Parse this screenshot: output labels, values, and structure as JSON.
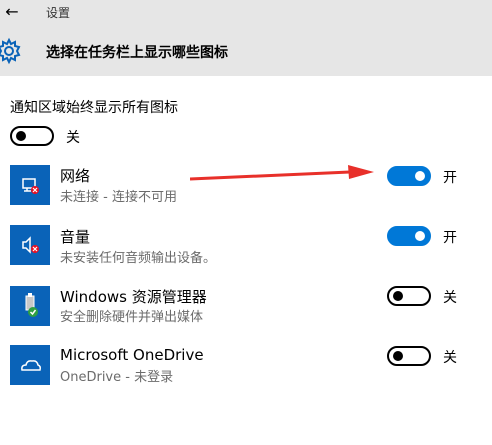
{
  "header": {
    "back_glyph": "←",
    "app_title": "设置",
    "page_title": "选择在任务栏上显示哪些图标"
  },
  "always_show": {
    "label": "通知区域始终显示所有图标",
    "state": "关",
    "on": false
  },
  "apps": [
    {
      "name": "网络",
      "status": "未连接 - 连接不可用",
      "state": "开",
      "on": true,
      "icon": "network-disconnected-icon"
    },
    {
      "name": "音量",
      "status": "未安装任何音频输出设备。",
      "state": "开",
      "on": true,
      "icon": "volume-muted-icon"
    },
    {
      "name": "Windows 资源管理器",
      "status": "安全删除硬件并弹出媒体",
      "state": "关",
      "on": false,
      "icon": "safely-remove-hardware-icon"
    },
    {
      "name": "Microsoft OneDrive",
      "status": "OneDrive - 未登录",
      "state": "关",
      "on": false,
      "icon": "onedrive-cloud-icon"
    }
  ],
  "colors": {
    "accent": "#0078d7",
    "icon_tile": "#0a63b8",
    "annotation_arrow": "#e8302a",
    "header_bg": "#e6e6e6"
  }
}
